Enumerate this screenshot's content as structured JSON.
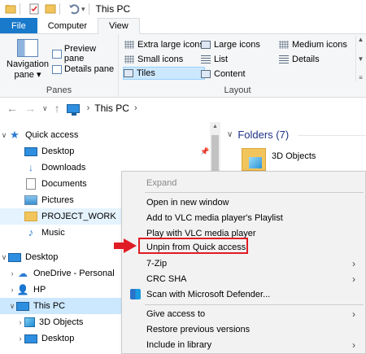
{
  "window": {
    "title": "This PC"
  },
  "ribbon": {
    "tabs": [
      {
        "label": "File"
      },
      {
        "label": "Computer"
      },
      {
        "label": "View"
      }
    ],
    "panes_group": {
      "navigation_pane": "Navigation pane",
      "navigation_pane_arrow": "▾",
      "preview_pane": "Preview pane",
      "details_pane": "Details pane",
      "label": "Panes"
    },
    "layout_group": {
      "items": [
        {
          "label": "Extra large icons"
        },
        {
          "label": "Large icons"
        },
        {
          "label": "Medium icons"
        },
        {
          "label": "Small icons"
        },
        {
          "label": "List"
        },
        {
          "label": "Details"
        },
        {
          "label": "Tiles"
        },
        {
          "label": "Content"
        }
      ],
      "label": "Layout"
    }
  },
  "address": {
    "location": "This PC"
  },
  "navtree": {
    "items": [
      {
        "label": "Quick access",
        "icon": "star-icon"
      },
      {
        "label": "Desktop",
        "icon": "desktop-icon"
      },
      {
        "label": "Downloads",
        "icon": "download-icon"
      },
      {
        "label": "Documents",
        "icon": "document-icon"
      },
      {
        "label": "Pictures",
        "icon": "pictures-icon"
      },
      {
        "label": "PROJECT_WORK",
        "icon": "folder-icon"
      },
      {
        "label": "Music",
        "icon": "music-icon"
      },
      {
        "label": "Desktop",
        "icon": "desktop-icon"
      },
      {
        "label": "OneDrive - Personal",
        "icon": "cloud-icon"
      },
      {
        "label": "HP",
        "icon": "user-icon"
      },
      {
        "label": "This PC",
        "icon": "pc-icon"
      },
      {
        "label": "3D Objects",
        "icon": "3d-objects-icon"
      },
      {
        "label": "Desktop",
        "icon": "desktop-icon"
      }
    ]
  },
  "content": {
    "folders_header": "Folders (7)",
    "first_folder": "3D Objects"
  },
  "context_menu": {
    "items": [
      {
        "label": "Expand"
      },
      {
        "label": "Open in new window"
      },
      {
        "label": "Add to VLC media player's Playlist"
      },
      {
        "label": "Play with VLC media player"
      },
      {
        "label": "Unpin from Quick access"
      },
      {
        "label": "7-Zip"
      },
      {
        "label": "CRC SHA"
      },
      {
        "label": "Scan with Microsoft Defender..."
      },
      {
        "label": "Give access to"
      },
      {
        "label": "Restore previous versions"
      },
      {
        "label": "Include in library"
      }
    ]
  },
  "colors": {
    "accent": "#1979ca",
    "selection": "#cce8ff",
    "highlight_border": "#e01c24",
    "folder_header": "#1e3287"
  }
}
